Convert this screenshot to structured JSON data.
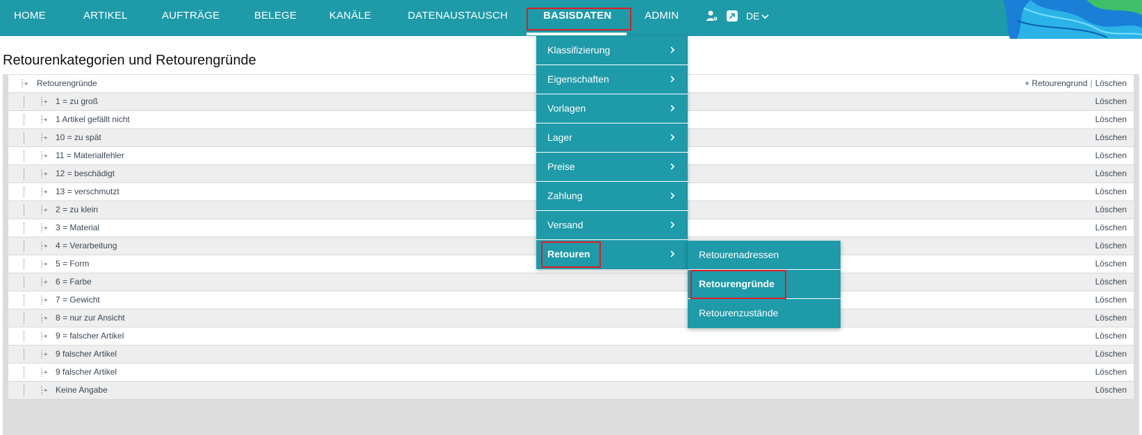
{
  "nav": {
    "items": [
      {
        "label": "HOME"
      },
      {
        "label": "ARTIKEL"
      },
      {
        "label": "AUFTRÄGE"
      },
      {
        "label": "BELEGE"
      },
      {
        "label": "KANÄLE"
      },
      {
        "label": "DATENAUSTAUSCH"
      },
      {
        "label": "BASISDATEN"
      },
      {
        "label": "ADMIN"
      }
    ],
    "active": "BASISDATEN",
    "language": "DE",
    "icons": [
      "user-settings-icon",
      "external-link-icon",
      "chevron-down-icon"
    ]
  },
  "page": {
    "title": "Retourenkategorien und Retourengründe"
  },
  "tree": {
    "root": {
      "label": "Retourengründe",
      "add_label": "+ Retourengrund",
      "delete_label": "Löschen"
    },
    "items": [
      {
        "label": "1 = zu groß",
        "action": "Löschen"
      },
      {
        "label": "1 Artikel gefällt nicht",
        "action": "Löschen"
      },
      {
        "label": "10 = zu spät",
        "action": "Löschen"
      },
      {
        "label": "11 = Materialfehler",
        "action": "Löschen"
      },
      {
        "label": "12 = beschädigt",
        "action": "Löschen"
      },
      {
        "label": "13 = verschmutzt",
        "action": "Löschen"
      },
      {
        "label": "2 = zu klein",
        "action": "Löschen"
      },
      {
        "label": "3 = Material",
        "action": "Löschen"
      },
      {
        "label": "4 = Verarbeitung",
        "action": "Löschen"
      },
      {
        "label": "5 = Form",
        "action": "Löschen"
      },
      {
        "label": "6 = Farbe",
        "action": "Löschen"
      },
      {
        "label": "7 = Gewicht",
        "action": "Löschen"
      },
      {
        "label": "8 = nur zur Ansicht",
        "action": "Löschen"
      },
      {
        "label": "9 = falscher Artikel",
        "action": "Löschen"
      },
      {
        "label": "9 falscher Artikel",
        "action": "Löschen"
      },
      {
        "label": "9 falscher Artikel",
        "action": "Löschen"
      },
      {
        "label": "Keine Angabe",
        "action": "Löschen"
      }
    ]
  },
  "dropdown": {
    "items": [
      {
        "label": "Klassifizierung"
      },
      {
        "label": "Eigenschaften"
      },
      {
        "label": "Vorlagen"
      },
      {
        "label": "Lager"
      },
      {
        "label": "Preise"
      },
      {
        "label": "Zahlung"
      },
      {
        "label": "Versand"
      },
      {
        "label": "Retouren"
      }
    ],
    "active": "Retouren"
  },
  "submenu": {
    "items": [
      {
        "label": "Retourenadressen"
      },
      {
        "label": "Retourengründe"
      },
      {
        "label": "Retourenzustände"
      }
    ],
    "active": "Retourengründe"
  },
  "colors": {
    "accent": "#1e9aa8",
    "highlight": "#e01b24",
    "text": "#3a4756"
  }
}
